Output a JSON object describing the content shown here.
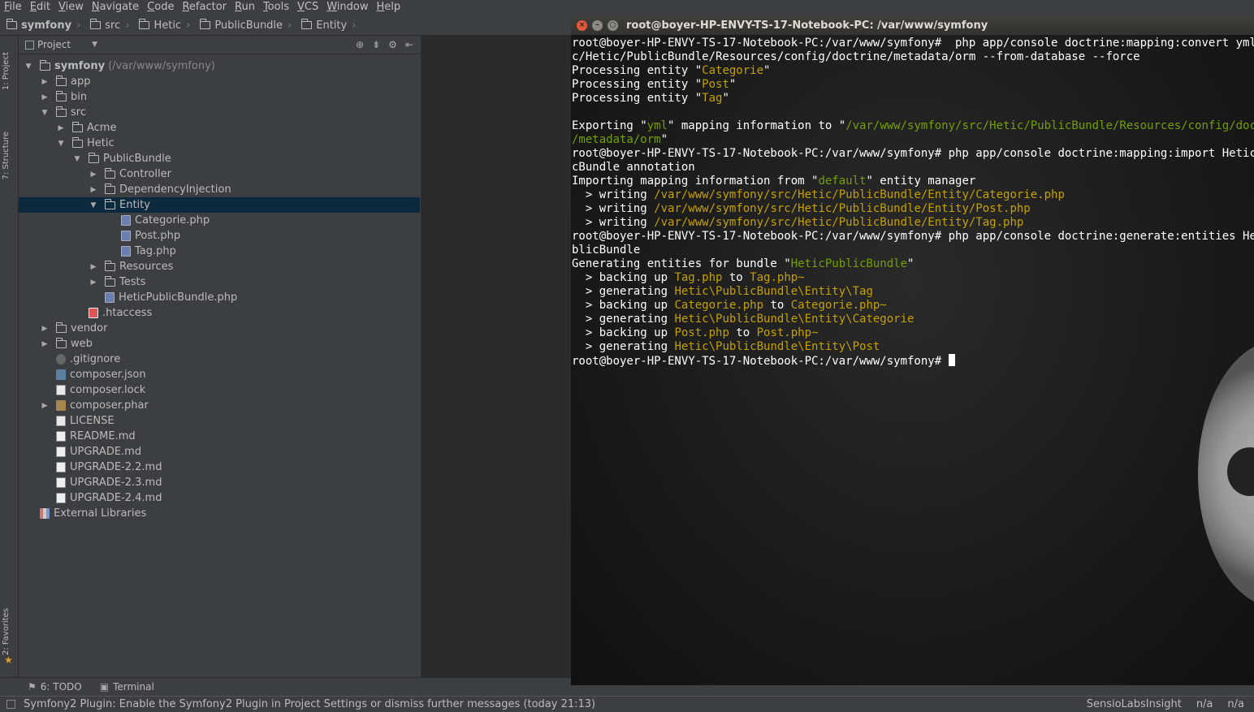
{
  "menu": [
    "File",
    "Edit",
    "View",
    "Navigate",
    "Code",
    "Refactor",
    "Run",
    "Tools",
    "VCS",
    "Window",
    "Help"
  ],
  "breadcrumb": [
    "symfony",
    "src",
    "Hetic",
    "PublicBundle",
    "Entity"
  ],
  "project_panel": {
    "title": "Project",
    "tree": [
      {
        "label": "symfony",
        "extra": "(/var/www/symfony)",
        "depth": 0,
        "icon": "folder-icon",
        "expand": "open",
        "bold": true
      },
      {
        "label": "app",
        "depth": 1,
        "icon": "folder-icon",
        "expand": "closed"
      },
      {
        "label": "bin",
        "depth": 1,
        "icon": "folder-icon",
        "expand": "closed"
      },
      {
        "label": "src",
        "depth": 1,
        "icon": "folder-icon",
        "expand": "open"
      },
      {
        "label": "Acme",
        "depth": 2,
        "icon": "folder-icon",
        "expand": "closed"
      },
      {
        "label": "Hetic",
        "depth": 2,
        "icon": "folder-icon",
        "expand": "open"
      },
      {
        "label": "PublicBundle",
        "depth": 3,
        "icon": "folder-icon",
        "expand": "open"
      },
      {
        "label": "Controller",
        "depth": 4,
        "icon": "folder-icon",
        "expand": "closed"
      },
      {
        "label": "DependencyInjection",
        "depth": 4,
        "icon": "folder-icon",
        "expand": "closed"
      },
      {
        "label": "Entity",
        "depth": 4,
        "icon": "folder-icon",
        "expand": "open",
        "selected": true
      },
      {
        "label": "Categorie.php",
        "depth": 5,
        "icon": "php-file-icon"
      },
      {
        "label": "Post.php",
        "depth": 5,
        "icon": "php-file-icon"
      },
      {
        "label": "Tag.php",
        "depth": 5,
        "icon": "php-file-icon"
      },
      {
        "label": "Resources",
        "depth": 4,
        "icon": "folder-icon",
        "expand": "closed"
      },
      {
        "label": "Tests",
        "depth": 4,
        "icon": "folder-icon",
        "expand": "closed"
      },
      {
        "label": "HeticPublicBundle.php",
        "depth": 4,
        "icon": "php-file-icon"
      },
      {
        "label": ".htaccess",
        "depth": 3,
        "icon": "htaccess-file-icon"
      },
      {
        "label": "vendor",
        "depth": 1,
        "icon": "folder-icon",
        "expand": "closed"
      },
      {
        "label": "web",
        "depth": 1,
        "icon": "folder-icon",
        "expand": "closed"
      },
      {
        "label": ".gitignore",
        "depth": 1,
        "icon": "gitignore-file-icon"
      },
      {
        "label": "composer.json",
        "depth": 1,
        "icon": "json-file-icon"
      },
      {
        "label": "composer.lock",
        "depth": 1,
        "icon": "text-file-icon"
      },
      {
        "label": "composer.phar",
        "depth": 1,
        "icon": "phar-archive-icon",
        "expand": "closed"
      },
      {
        "label": "LICENSE",
        "depth": 1,
        "icon": "text-file-icon"
      },
      {
        "label": "README.md",
        "depth": 1,
        "icon": "markdown-file-icon"
      },
      {
        "label": "UPGRADE.md",
        "depth": 1,
        "icon": "markdown-file-icon"
      },
      {
        "label": "UPGRADE-2.2.md",
        "depth": 1,
        "icon": "markdown-file-icon"
      },
      {
        "label": "UPGRADE-2.3.md",
        "depth": 1,
        "icon": "markdown-file-icon"
      },
      {
        "label": "UPGRADE-2.4.md",
        "depth": 1,
        "icon": "markdown-file-icon"
      },
      {
        "label": "External Libraries",
        "depth": 0,
        "icon": "external-libraries-icon"
      }
    ]
  },
  "side_tabs": {
    "project": "1: Project",
    "structure": "7: Structure",
    "favorites": "2: Favorites"
  },
  "bottom_tabs": {
    "todo": "6: TODO",
    "terminal": "Terminal"
  },
  "status": {
    "message": "Symfony2 Plugin: Enable the Symfony2 Plugin in Project Settings or dismiss further messages (today 21:13)",
    "insight": "SensioLabsInsight",
    "na1": "n/a",
    "na2": "n/a"
  },
  "terminal": {
    "title": "root@boyer-HP-ENVY-TS-17-Notebook-PC: /var/www/symfony",
    "lines": [
      [
        {
          "t": "root@boyer-HP-ENVY-TS-17-Notebook-PC:/var/www/symfony#  php app/console doctrine:mapping:convert yml ./sr"
        }
      ],
      [
        {
          "t": "c/Hetic/PublicBundle/Resources/config/doctrine/metadata/orm --from-database --force"
        }
      ],
      [
        {
          "t": "Processing entity \""
        },
        {
          "t": "Categorie",
          "c": "y"
        },
        {
          "t": "\""
        }
      ],
      [
        {
          "t": "Processing entity \""
        },
        {
          "t": "Post",
          "c": "y"
        },
        {
          "t": "\""
        }
      ],
      [
        {
          "t": "Processing entity \""
        },
        {
          "t": "Tag",
          "c": "y"
        },
        {
          "t": "\""
        }
      ],
      [
        {
          "t": ""
        }
      ],
      [
        {
          "t": "Exporting \""
        },
        {
          "t": "yml",
          "c": "g"
        },
        {
          "t": "\" mapping information to \""
        },
        {
          "t": "/var/www/symfony/src/Hetic/PublicBundle/Resources/config/doctrine",
          "c": "g"
        }
      ],
      [
        {
          "t": "/metadata/orm",
          "c": "g"
        },
        {
          "t": "\""
        }
      ],
      [
        {
          "t": "root@boyer-HP-ENVY-TS-17-Notebook-PC:/var/www/symfony# php app/console doctrine:mapping:import HeticPubli"
        }
      ],
      [
        {
          "t": "cBundle annotation"
        }
      ],
      [
        {
          "t": "Importing mapping information from \""
        },
        {
          "t": "default",
          "c": "g"
        },
        {
          "t": "\" entity manager"
        }
      ],
      [
        {
          "t": "  > writing "
        },
        {
          "t": "/var/www/symfony/src/Hetic/PublicBundle/Entity/Categorie.php",
          "c": "y"
        }
      ],
      [
        {
          "t": "  > writing "
        },
        {
          "t": "/var/www/symfony/src/Hetic/PublicBundle/Entity/Post.php",
          "c": "y"
        }
      ],
      [
        {
          "t": "  > writing "
        },
        {
          "t": "/var/www/symfony/src/Hetic/PublicBundle/Entity/Tag.php",
          "c": "y"
        }
      ],
      [
        {
          "t": "root@boyer-HP-ENVY-TS-17-Notebook-PC:/var/www/symfony# php app/console doctrine:generate:entities HeticPu"
        }
      ],
      [
        {
          "t": "blicBundle"
        }
      ],
      [
        {
          "t": "Generating entities for bundle \""
        },
        {
          "t": "HeticPublicBundle",
          "c": "g"
        },
        {
          "t": "\""
        }
      ],
      [
        {
          "t": "  > backing up "
        },
        {
          "t": "Tag.php",
          "c": "y"
        },
        {
          "t": " to "
        },
        {
          "t": "Tag.php~",
          "c": "y"
        }
      ],
      [
        {
          "t": "  > generating "
        },
        {
          "t": "Hetic\\PublicBundle\\Entity\\Tag",
          "c": "y"
        }
      ],
      [
        {
          "t": "  > backing up "
        },
        {
          "t": "Categorie.php",
          "c": "y"
        },
        {
          "t": " to "
        },
        {
          "t": "Categorie.php~",
          "c": "y"
        }
      ],
      [
        {
          "t": "  > generating "
        },
        {
          "t": "Hetic\\PublicBundle\\Entity\\Categorie",
          "c": "y"
        }
      ],
      [
        {
          "t": "  > backing up "
        },
        {
          "t": "Post.php",
          "c": "y"
        },
        {
          "t": " to "
        },
        {
          "t": "Post.php~",
          "c": "y"
        }
      ],
      [
        {
          "t": "  > generating "
        },
        {
          "t": "Hetic\\PublicBundle\\Entity\\Post",
          "c": "y"
        }
      ],
      [
        {
          "t": "root@boyer-HP-ENVY-TS-17-Notebook-PC:/var/www/symfony# "
        }
      ]
    ]
  }
}
